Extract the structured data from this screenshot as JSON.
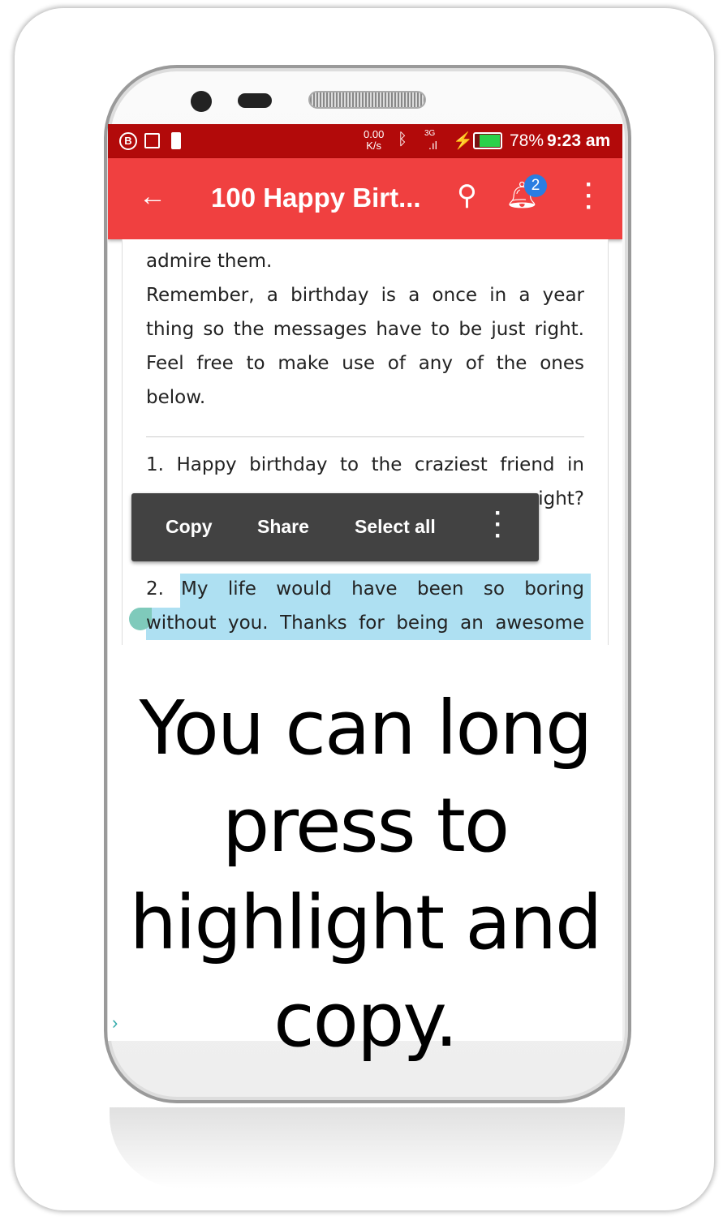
{
  "status_bar": {
    "net_speed_value": "0.00",
    "net_speed_unit": "K/s",
    "network": "3G",
    "battery": "78%",
    "time": "9:23 am",
    "battery_level": 0.78
  },
  "toolbar": {
    "title": "100 Happy Birt...",
    "notification_count": "2"
  },
  "content": {
    "para1": "admire them.",
    "para2": "Remember, a birthday is a once in a year thing so the messages have to be just right. Feel free to make use of any of the ones below.",
    "item1_line1": "1. Happy birthday to the craziest friend in",
    "item1_line2_visible": "ight?",
    "item2_number": "2.",
    "item2_line1": "My life would have been so boring",
    "item2_line2": "without you. Thanks for being an awesome"
  },
  "selection_menu": {
    "copy": "Copy",
    "share": "Share",
    "select_all": "Select all"
  },
  "caption": "You can long press to highlight and copy.",
  "colors": {
    "status_bar": "#b20a0a",
    "toolbar": "#f04040",
    "selection": "#aee0f2",
    "badge": "#2a7de1"
  }
}
